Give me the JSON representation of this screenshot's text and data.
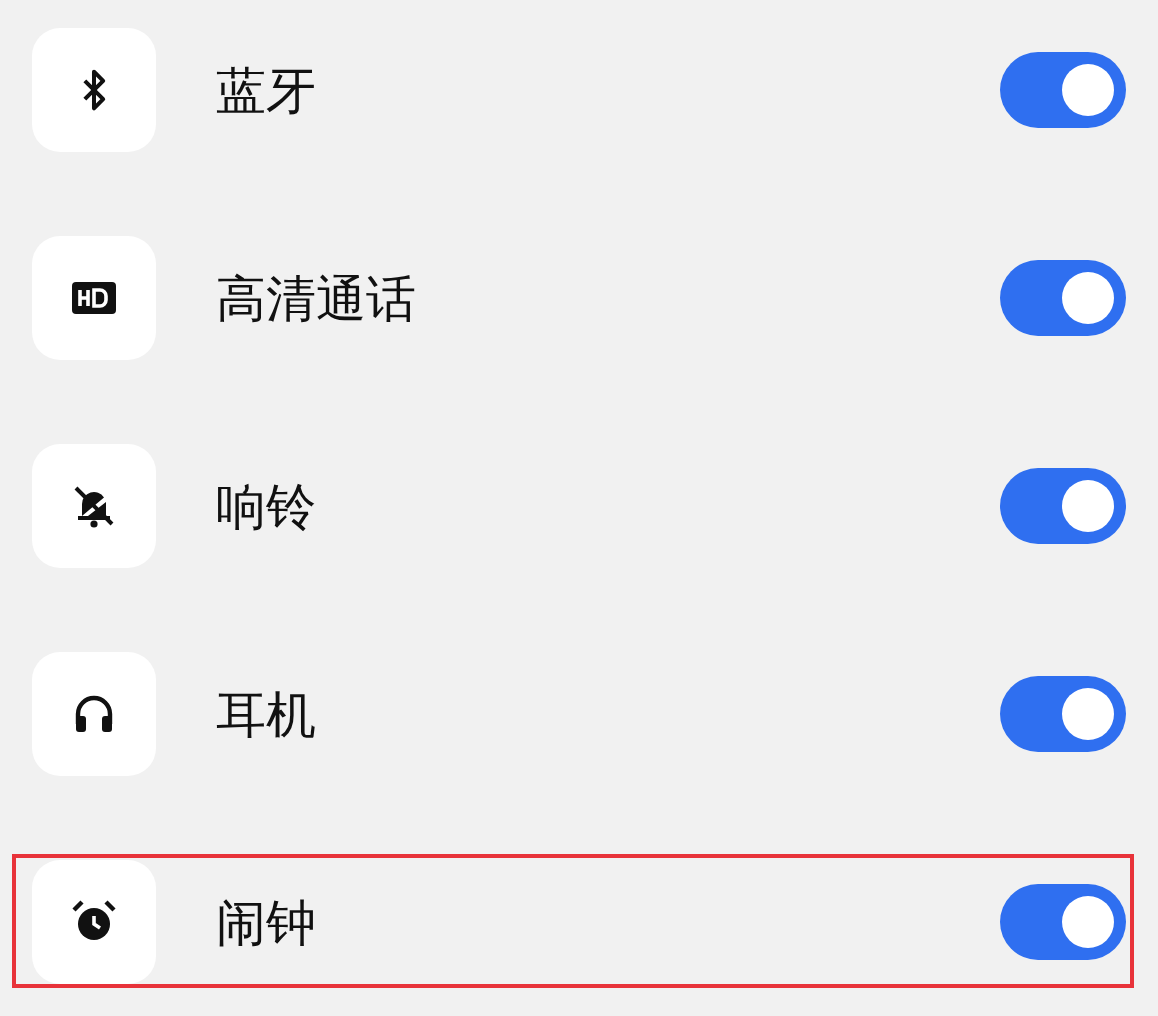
{
  "rows": [
    {
      "kind": "bluetooth",
      "label": "蓝牙",
      "on": true,
      "highlighted": false
    },
    {
      "kind": "hd",
      "label": "高清通话",
      "on": true,
      "highlighted": false
    },
    {
      "kind": "bell",
      "label": "响铃",
      "on": true,
      "highlighted": false
    },
    {
      "kind": "headphones",
      "label": "耳机",
      "on": true,
      "highlighted": false
    },
    {
      "kind": "alarm",
      "label": "闹钟",
      "on": true,
      "highlighted": true
    }
  ]
}
